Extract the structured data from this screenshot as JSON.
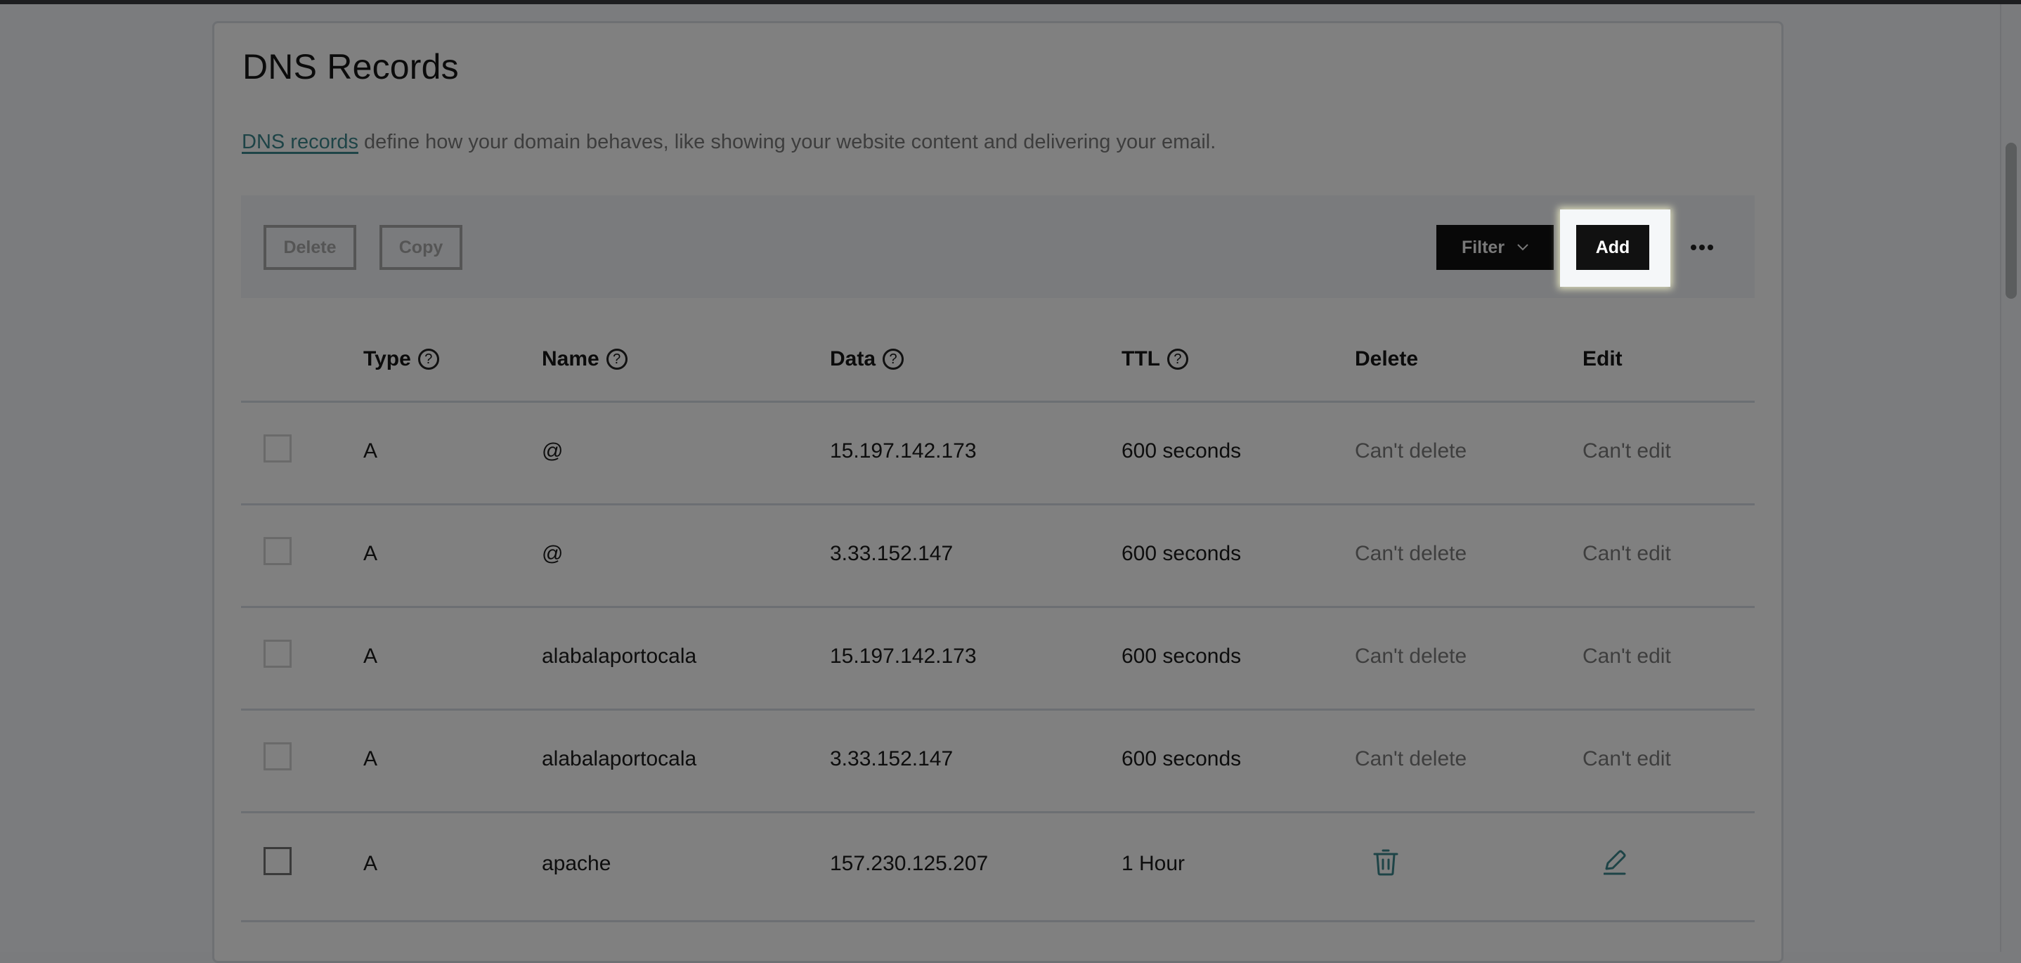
{
  "page": {
    "title": "DNS Records",
    "description_link": "DNS records",
    "description_text": " define how your domain behaves, like showing your website content and delivering your email."
  },
  "toolbar": {
    "delete_label": "Delete",
    "copy_label": "Copy",
    "filter_label": "Filter",
    "add_label": "Add",
    "more_icon": "more-horizontal-icon"
  },
  "table": {
    "headers": {
      "type": "Type",
      "name": "Name",
      "data": "Data",
      "ttl": "TTL",
      "delete": "Delete",
      "edit": "Edit"
    },
    "help_glyph": "?",
    "rows": [
      {
        "type": "A",
        "name": "@",
        "data": "15.197.142.173",
        "ttl": "600 seconds",
        "delete": "Can't delete",
        "edit": "Can't edit"
      },
      {
        "type": "A",
        "name": "@",
        "data": "3.33.152.147",
        "ttl": "600 seconds",
        "delete": "Can't delete",
        "edit": "Can't edit"
      },
      {
        "type": "A",
        "name": "alabalaportocala",
        "data": "15.197.142.173",
        "ttl": "600 seconds",
        "delete": "Can't delete",
        "edit": "Can't edit"
      },
      {
        "type": "A",
        "name": "alabalaportocala",
        "data": "3.33.152.147",
        "ttl": "600 seconds",
        "delete": "Can't delete",
        "edit": "Can't edit"
      },
      {
        "type": "A",
        "name": "apache",
        "data": "157.230.125.207",
        "ttl": "1 Hour",
        "delete_icon": "trash-icon",
        "edit_icon": "pencil-icon"
      }
    ]
  },
  "colors": {
    "link": "#1e4447",
    "icon_accent": "#1e4447",
    "overlay_bg": "#7b7c7e",
    "highlight": "#f5f7f9"
  }
}
